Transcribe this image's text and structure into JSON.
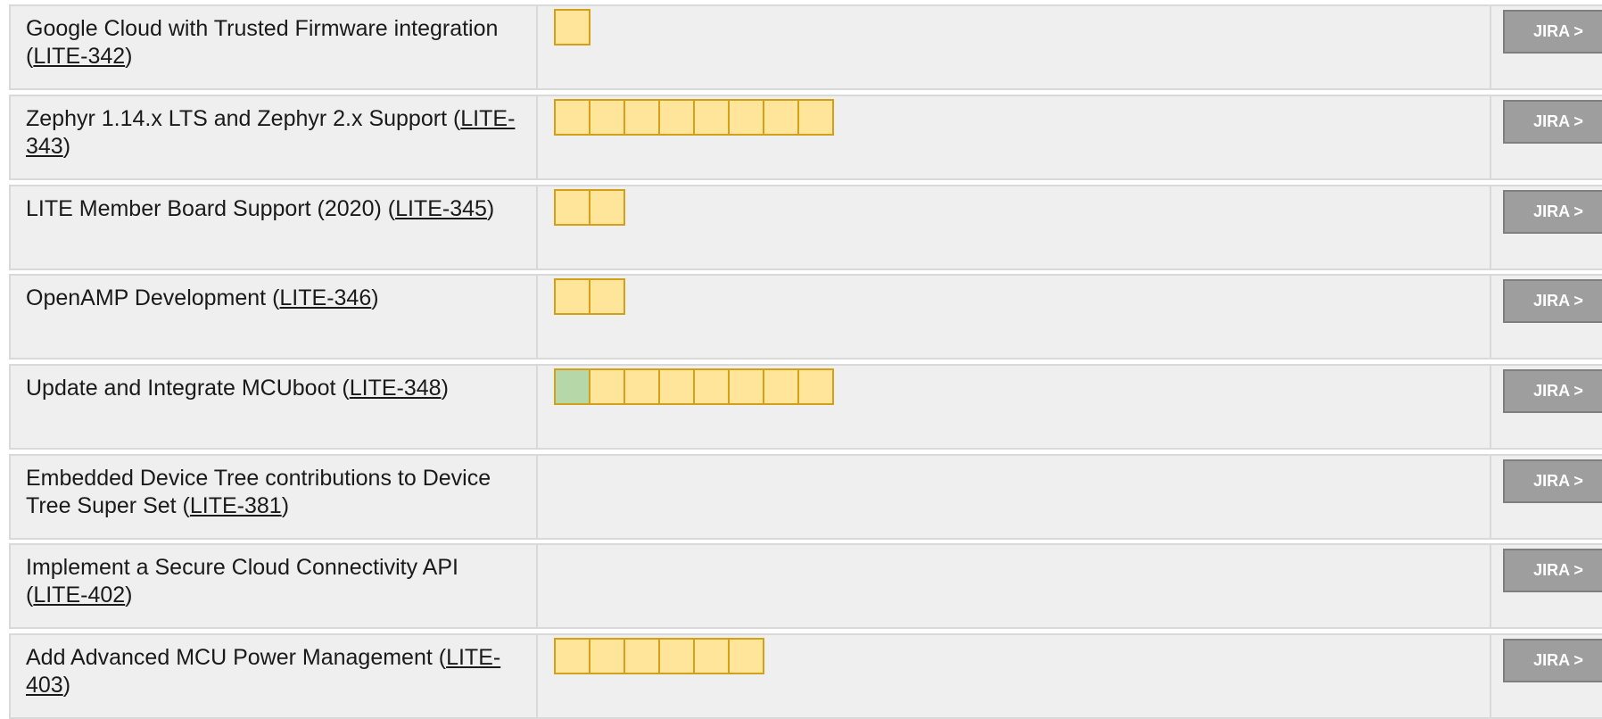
{
  "button_label": "JIRA >",
  "colors": {
    "row_bg": "#efefef",
    "pending_box": "#ffe599",
    "done_box": "#b6d7a8",
    "box_border": "#d4a017",
    "button_bg": "#9e9e9e"
  },
  "rows": [
    {
      "text_before": "Google Cloud with Trusted Firmware integration (",
      "link": "LITE-342",
      "text_after": ")",
      "done": 0,
      "pending": 1
    },
    {
      "text_before": "Zephyr 1.14.x LTS and Zephyr 2.x Support (",
      "link": "LITE-343",
      "text_after": ")",
      "done": 0,
      "pending": 8
    },
    {
      "text_before": "LITE Member Board Support (2020) (",
      "link": "LITE-345",
      "text_after": ")",
      "done": 0,
      "pending": 2
    },
    {
      "text_before": "OpenAMP Development  (",
      "link": "LITE-346",
      "text_after": ")",
      "done": 0,
      "pending": 2
    },
    {
      "text_before": "Update and Integrate MCUboot  (",
      "link": "LITE-348",
      "text_after": ")",
      "done": 1,
      "pending": 7
    },
    {
      "text_before": "Embedded Device Tree contributions to Device Tree Super Set (",
      "link": "LITE-381",
      "text_after": ")",
      "done": 0,
      "pending": 0
    },
    {
      "text_before": "Implement a Secure Cloud Connectivity API (",
      "link": "LITE-402",
      "text_after": ")",
      "done": 0,
      "pending": 0
    },
    {
      "text_before": "Add Advanced MCU Power Management (",
      "link": "LITE-403",
      "text_after": ")",
      "done": 0,
      "pending": 6
    }
  ]
}
